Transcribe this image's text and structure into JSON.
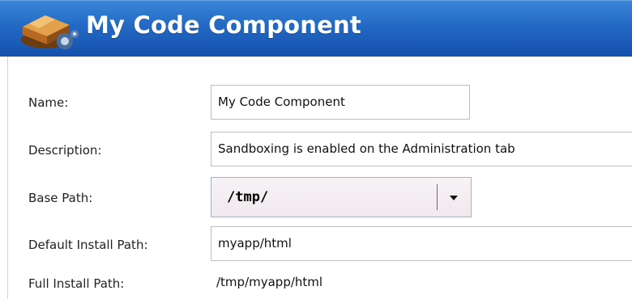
{
  "header": {
    "title": "My Code Component",
    "icon": "code-component-icon"
  },
  "form": {
    "name": {
      "label": "Name:",
      "value": "My Code Component"
    },
    "description": {
      "label": "Description:",
      "value": "Sandboxing is enabled on the Administration tab"
    },
    "base_path": {
      "label": "Base Path:",
      "value": "/tmp/"
    },
    "default_install_path": {
      "label": "Default Install Path:",
      "value": "myapp/html"
    },
    "full_install_path": {
      "label": "Full Install Path:",
      "value": "/tmp/myapp/html"
    }
  },
  "colors": {
    "header_top": "#3a86d8",
    "header_bottom": "#1550ad",
    "field_border": "#b9bec6"
  }
}
